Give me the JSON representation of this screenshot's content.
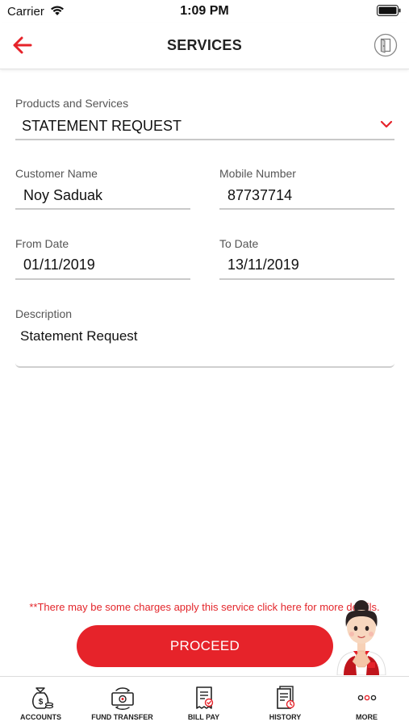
{
  "status_bar": {
    "carrier": "Carrier",
    "time": "1:09 PM"
  },
  "header": {
    "title": "SERVICES",
    "back_icon": "arrow-left-icon",
    "logout_icon": "door-exit-icon",
    "accent_color": "#e6232a"
  },
  "form": {
    "product": {
      "label": "Products and Services",
      "value": "STATEMENT REQUEST"
    },
    "customer_name": {
      "label": "Customer Name",
      "value": "Noy Saduak"
    },
    "mobile_number": {
      "label": "Mobile Number",
      "value": "87737714"
    },
    "from_date": {
      "label": "From Date",
      "value": "01/11/2019"
    },
    "to_date": {
      "label": "To Date",
      "value": "13/11/2019"
    },
    "description": {
      "label": "Description",
      "value": "Statement Request"
    }
  },
  "footer": {
    "charges_note": "**There may be some charges apply this service click here for more details.",
    "proceed_label": "PROCEED"
  },
  "tab_bar": {
    "items": [
      {
        "label": "ACCOUNTS",
        "icon": "money-bag-icon"
      },
      {
        "label": "FUND TRANSFER",
        "icon": "money-transfer-icon"
      },
      {
        "label": "BILL PAY",
        "icon": "bill-icon"
      },
      {
        "label": "HISTORY",
        "icon": "history-icon"
      },
      {
        "label": "MORE",
        "icon": "more-dots-icon"
      }
    ]
  }
}
